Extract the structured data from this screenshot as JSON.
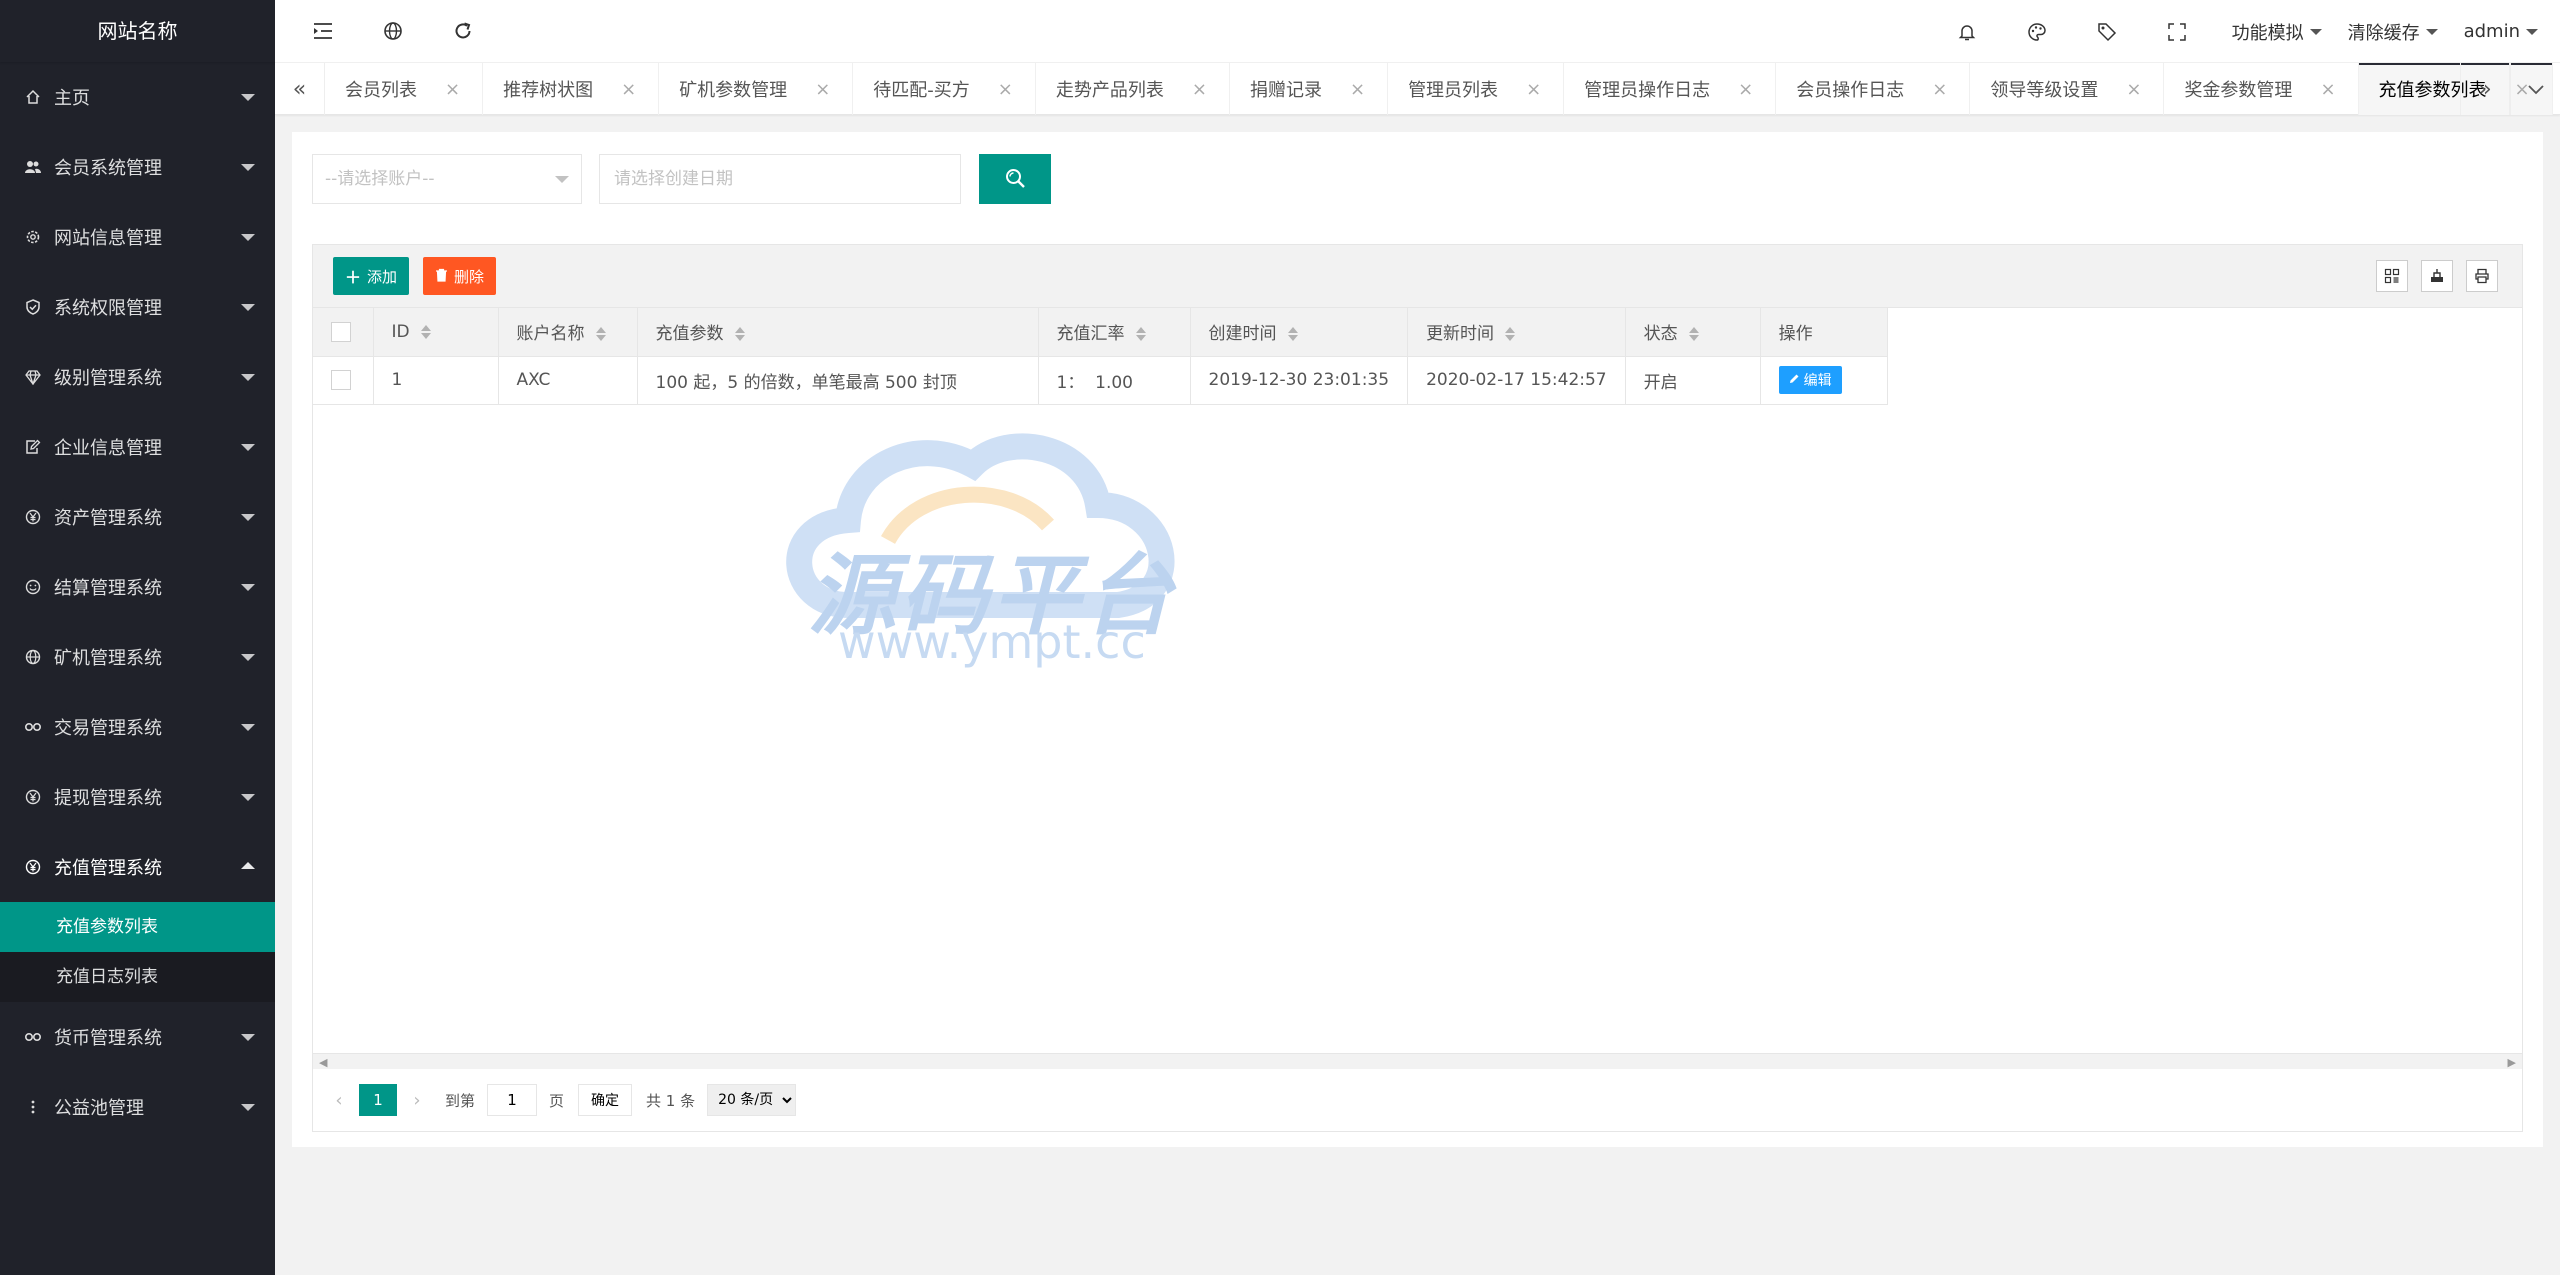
{
  "site_name": "网站名称",
  "sidebar": {
    "items": [
      {
        "label": "主页",
        "icon": "home-icon"
      },
      {
        "label": "会员系统管理",
        "icon": "users-icon"
      },
      {
        "label": "网站信息管理",
        "icon": "gear-icon"
      },
      {
        "label": "系统权限管理",
        "icon": "shield-icon"
      },
      {
        "label": "级别管理系统",
        "icon": "diamond-icon"
      },
      {
        "label": "企业信息管理",
        "icon": "edit-doc-icon"
      },
      {
        "label": "资产管理系统",
        "icon": "yen-icon"
      },
      {
        "label": "结算管理系统",
        "icon": "smile-icon"
      },
      {
        "label": "矿机管理系统",
        "icon": "globe-icon"
      },
      {
        "label": "交易管理系统",
        "icon": "link-icon"
      },
      {
        "label": "提现管理系统",
        "icon": "yen-icon"
      },
      {
        "label": "充值管理系统",
        "icon": "yen-icon"
      },
      {
        "label": "货币管理系统",
        "icon": "link-icon"
      },
      {
        "label": "公益池管理",
        "icon": "more-vertical-icon"
      }
    ],
    "submenu": [
      {
        "label": "充值参数列表",
        "active": true
      },
      {
        "label": "充值日志列表",
        "active": false
      }
    ]
  },
  "header": {
    "func_sim": "功能模拟",
    "clear_cache": "清除缓存",
    "user": "admin"
  },
  "tabs": [
    "会员列表",
    "推荐树状图",
    "矿机参数管理",
    "待匹配-买方",
    "走势产品列表",
    "捐赠记录",
    "管理员列表",
    "管理员操作日志",
    "会员操作日志",
    "领导等级设置",
    "奖金参数管理",
    "充值参数列表"
  ],
  "active_tab": "充值参数列表",
  "search": {
    "account_placeholder": "--请选择账户--",
    "date_placeholder": "请选择创建日期"
  },
  "toolbar": {
    "add_label": "添加",
    "delete_label": "删除"
  },
  "table": {
    "headers": [
      "ID",
      "账户名称",
      "充值参数",
      "充值汇率",
      "创建时间",
      "更新时间",
      "状态",
      "操作"
    ],
    "rows": [
      {
        "id": "1",
        "account": "AXC",
        "param": "100 起，5 的倍数，单笔最高 500 封顶",
        "rate": "1：  1.00",
        "created": "2019-12-30 23:01:35",
        "updated": "2020-02-17 15:42:57",
        "status": "开启",
        "action": "编辑"
      }
    ]
  },
  "watermark": {
    "title": "源码平台",
    "url": "www.ympt.cc"
  },
  "pager": {
    "current": "1",
    "goto_label": "到第",
    "goto_value": "1",
    "page_unit": "页",
    "ok_label": "确定",
    "total": "共 1 条",
    "size": "20 条/页"
  },
  "colors": {
    "primary": "#009688",
    "danger": "#ff5722",
    "info": "#1e9fff",
    "sidebar_bg": "#20222a"
  }
}
